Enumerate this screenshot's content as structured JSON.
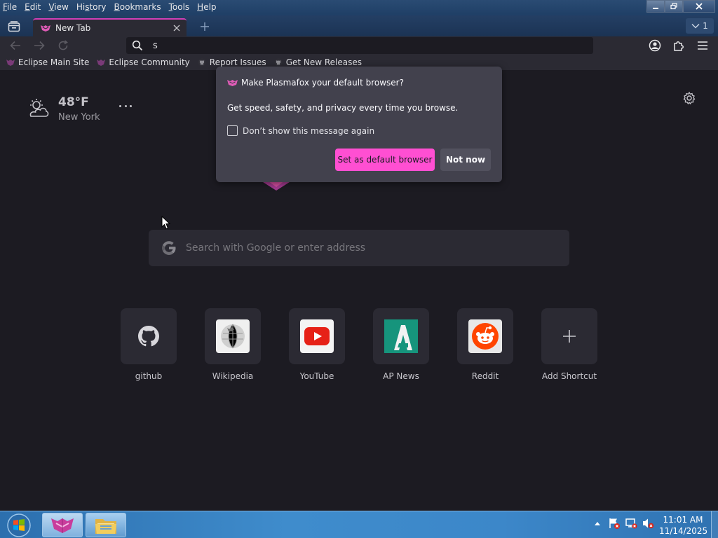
{
  "menu": {
    "items": [
      {
        "pre": "",
        "acc": "F",
        "post": "ile"
      },
      {
        "pre": "",
        "acc": "E",
        "post": "dit"
      },
      {
        "pre": "",
        "acc": "V",
        "post": "iew"
      },
      {
        "pre": "Hi",
        "acc": "s",
        "post": "tory"
      },
      {
        "pre": "",
        "acc": "B",
        "post": "ookmarks"
      },
      {
        "pre": "",
        "acc": "T",
        "post": "ools"
      },
      {
        "pre": "",
        "acc": "H",
        "post": "elp"
      }
    ]
  },
  "tabs": {
    "active_title": "New Tab",
    "count": "1"
  },
  "urlbar": {
    "value": "s"
  },
  "bookmarks": [
    {
      "label": "Eclipse Main Site",
      "icon": "eclipse-icon"
    },
    {
      "label": "Eclipse Community",
      "icon": "eclipse-icon"
    },
    {
      "label": "Report Issues",
      "icon": "github-icon"
    },
    {
      "label": "Get New Releases",
      "icon": "github-icon"
    }
  ],
  "weather": {
    "temp": "48°F",
    "city": "New York"
  },
  "search": {
    "placeholder": "Search with Google or enter address"
  },
  "shortcuts": [
    {
      "label": "github",
      "icon": "github-icon"
    },
    {
      "label": "Wikipedia",
      "icon": "wikipedia-icon"
    },
    {
      "label": "YouTube",
      "icon": "youtube-icon"
    },
    {
      "label": "AP News",
      "icon": "apnews-icon"
    },
    {
      "label": "Reddit",
      "icon": "reddit-icon"
    },
    {
      "label": "Add Shortcut",
      "icon": "plus-icon"
    }
  ],
  "popup": {
    "title": "Make Plasmafox your default browser?",
    "body": "Get speed, safety, and privacy every time you browse.",
    "checkbox_label": "Don’t show this message again",
    "primary_button": "Set as default browser",
    "secondary_button": "Not now"
  },
  "taskbar": {
    "time": "11:01 AM",
    "date": "11/14/2025"
  },
  "colors": {
    "accent": "#ff4fd2",
    "page_bg": "#1c1b22",
    "panel_bg": "#2b2a33",
    "popup_bg": "#42414d"
  }
}
